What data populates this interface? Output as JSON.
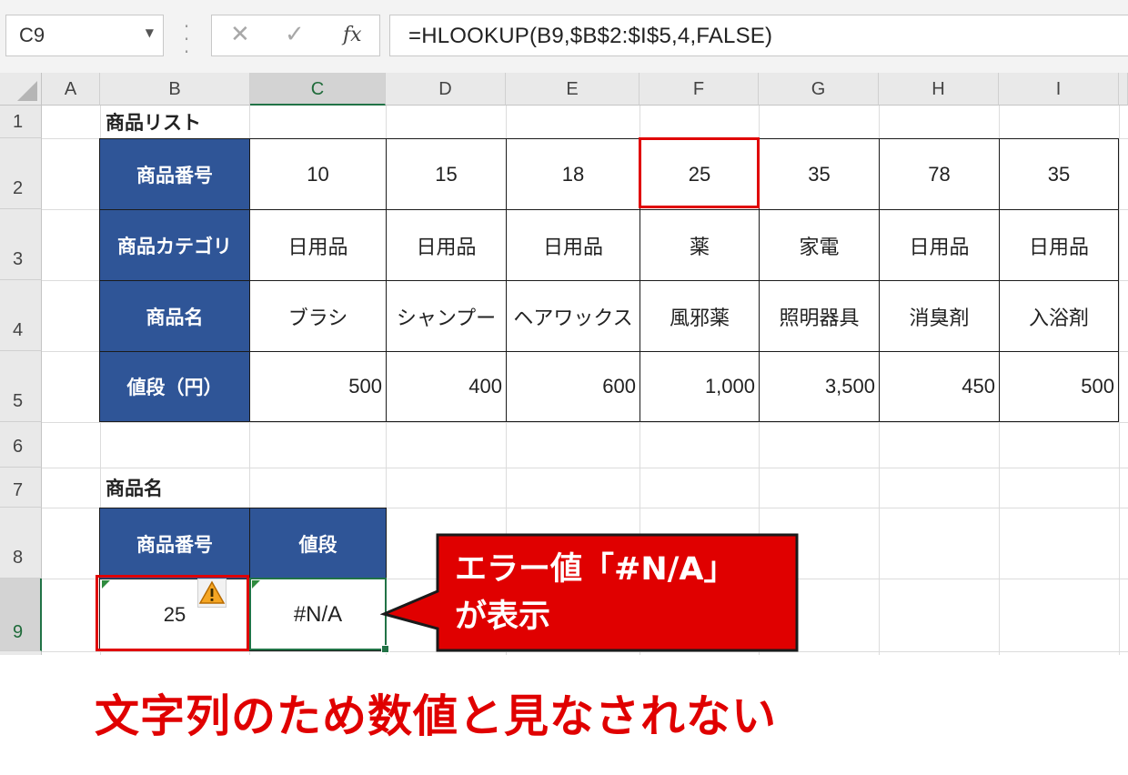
{
  "formula_bar": {
    "name_box": "C9",
    "cancel_icon": "x-icon",
    "enter_icon": "check-icon",
    "function_icon": "fx",
    "formula": "=HLOOKUP(B9,$B$2:$I$5,4,FALSE)"
  },
  "columns": [
    "A",
    "B",
    "C",
    "D",
    "E",
    "F",
    "G",
    "H",
    "I"
  ],
  "rows": [
    "1",
    "2",
    "3",
    "4",
    "5",
    "6",
    "7",
    "8",
    "9"
  ],
  "selected_cell": "C9",
  "table1": {
    "title": "商品リスト",
    "row_headers": [
      "商品番号",
      "商品カテゴリ",
      "商品名",
      "値段（円）"
    ],
    "product_numbers": [
      "10",
      "15",
      "18",
      "25",
      "35",
      "78",
      "35"
    ],
    "categories": [
      "日用品",
      "日用品",
      "日用品",
      "薬",
      "家電",
      "日用品",
      "日用品"
    ],
    "names": [
      "ブラシ",
      "シャンプー",
      "ヘアワックス",
      "風邪薬",
      "照明器具",
      "消臭剤",
      "入浴剤"
    ],
    "prices": [
      "500",
      "400",
      "600",
      "1,000",
      "3,500",
      "450",
      "500"
    ]
  },
  "table2": {
    "title": "商品名",
    "headers": [
      "商品番号",
      "値段"
    ],
    "input_value": "25",
    "result_value": "#N/A"
  },
  "callout": {
    "line1": "エラー値「#N/A」",
    "line2": "が表示"
  },
  "caption": "文字列のため数値と見なされない",
  "colors": {
    "header_fill": "#2f5597",
    "highlight": "#e00000",
    "selection": "#217346"
  }
}
